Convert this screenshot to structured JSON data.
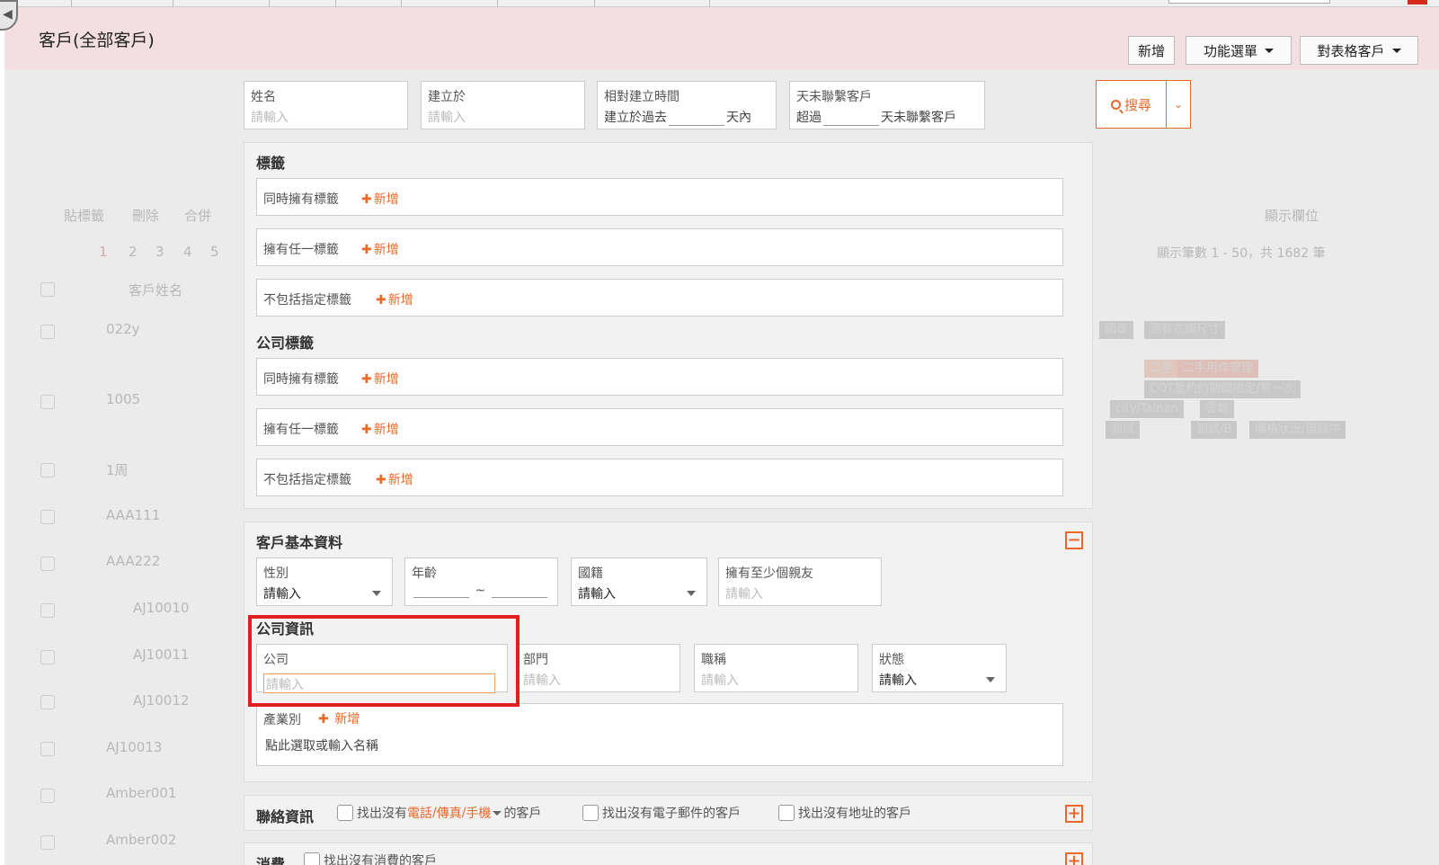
{
  "header": {
    "title": "客戶(全部客戶)",
    "btn_add": "新增",
    "btn_menu": "功能選單",
    "btn_compare": "對表格客戶"
  },
  "background": {
    "toolbar": [
      "貼標籤",
      "刪除",
      "合併"
    ],
    "display_columns": "顯示欄位",
    "pages": [
      "1",
      "2",
      "3",
      "4",
      "5"
    ],
    "range_text": "顯示筆數 1 - 50，共 1682 筆",
    "col_name": "客戶姓名",
    "rows": [
      "022y",
      "1005",
      "1周",
      "AAA111",
      "AAA222",
      "AJ10010",
      "AJ10011",
      "AJ10012",
      "AJ10013",
      "Amber001",
      "Amber002"
    ],
    "tags": [
      "國泰",
      "還有衣櫥尺寸",
      "二手",
      "已付款",
      "二手用作管理",
      "國泰",
      "小美",
      "COT",
      "COT意約的期間限定/第一次",
      "city/Tainan",
      "雲端",
      "網寵",
      "測試",
      "測試/B",
      "價格狀況/價錢中"
    ]
  },
  "filters": {
    "name": {
      "label": "姓名",
      "placeholder": "請輸入"
    },
    "created": {
      "label": "建立於",
      "placeholder": "請輸入"
    },
    "relative": {
      "label": "相對建立時間",
      "prefix": "建立於過去",
      "suffix": "天內"
    },
    "no_contact": {
      "label": "天未聯繫客戶",
      "prefix": "超過",
      "suffix": "天未聯繫客戶"
    }
  },
  "search": {
    "label": "搜尋"
  },
  "tags_section": {
    "title": "標籤",
    "rows": [
      {
        "label": "同時擁有標籤",
        "add": "新增"
      },
      {
        "label": "擁有任一標籤",
        "add": "新增"
      },
      {
        "label": "不包括指定標籤",
        "add": "新增"
      }
    ]
  },
  "company_tags_section": {
    "title": "公司標籤",
    "rows": [
      {
        "label": "同時擁有標籤",
        "add": "新增"
      },
      {
        "label": "擁有任一標籤",
        "add": "新增"
      },
      {
        "label": "不包括指定標籤",
        "add": "新增"
      }
    ]
  },
  "basic": {
    "title": "客戶基本資料",
    "gender": {
      "label": "性別",
      "value": "請輸入"
    },
    "age": {
      "label": "年齡",
      "sep": "~"
    },
    "nationality": {
      "label": "國籍",
      "value": "請輸入"
    },
    "friends": {
      "label": "擁有至少個親友",
      "placeholder": "請輸入"
    }
  },
  "company_info": {
    "title": "公司資訊",
    "company": {
      "label": "公司",
      "placeholder": "請輸入"
    },
    "dept": {
      "label": "部門",
      "placeholder": "請輸入"
    },
    "job": {
      "label": "職稱",
      "placeholder": "請輸入"
    },
    "status": {
      "label": "狀態",
      "value": "請輸入"
    },
    "industry": {
      "label": "產業別",
      "add": "新增",
      "hint": "點此選取或輸入名稱"
    }
  },
  "contact": {
    "title": "聯絡資訊",
    "opt1_a": "找出沒有",
    "opt1_phone": "電話",
    "opt1_fax": "傳真",
    "opt1_mobile": "手機",
    "opt1_b": "的客戶",
    "opt1_slash": "/",
    "opt2": "找出沒有電子郵件的客戶",
    "opt3": "找出沒有地址的客戶"
  },
  "spending": {
    "title": "消費",
    "opt1": "找出沒有消費的客戶"
  },
  "colors": {
    "accent": "#e8692a",
    "highlight": "#e02020",
    "header_bg": "#f3dfe1"
  }
}
